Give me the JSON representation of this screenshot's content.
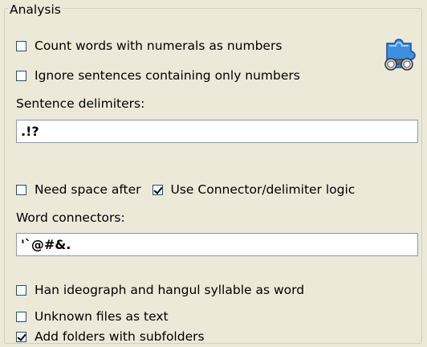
{
  "group": {
    "title": "Analysis"
  },
  "options": {
    "count_numerals": {
      "label": "Count words with numerals as numbers",
      "checked": false
    },
    "ignore_numbers": {
      "label": "Ignore sentences containing only numbers",
      "checked": false
    },
    "need_space_after": {
      "label": "Need space after",
      "checked": false
    },
    "use_connector_logic": {
      "label": "Use Connector/delimiter logic",
      "checked": true
    },
    "han_hangul_word": {
      "label": "Han ideograph and hangul syllable as word",
      "checked": false
    },
    "unknown_as_text": {
      "label": "Unknown files as text",
      "checked": false
    },
    "add_subfolders": {
      "label": "Add folders with subfolders",
      "checked": true
    }
  },
  "sentence_delimiters": {
    "label": "Sentence delimiters:",
    "value": ".!?"
  },
  "word_connectors": {
    "label": "Word connectors:",
    "value": "'`@#&."
  },
  "icons": {
    "plugin": "puzzle-magnifier-icon"
  }
}
